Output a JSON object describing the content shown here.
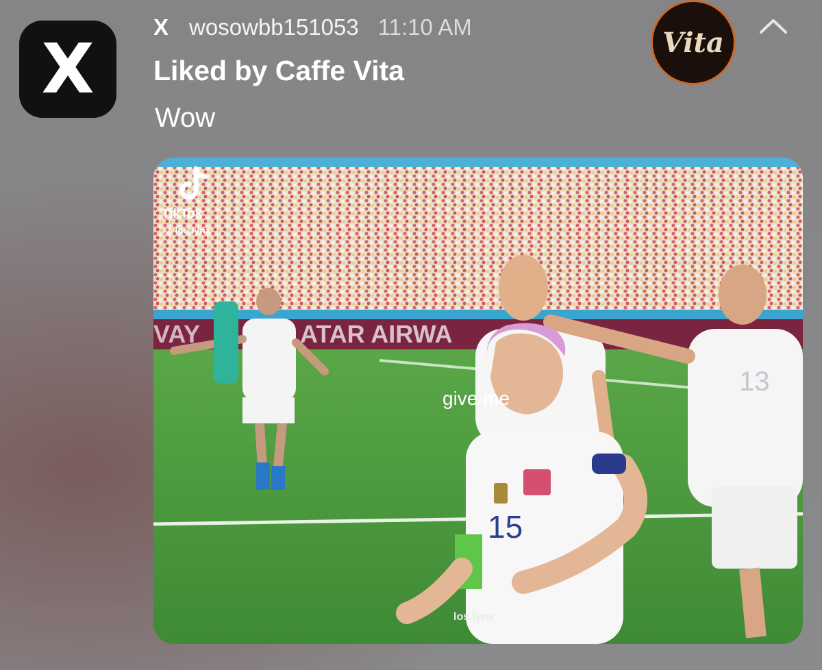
{
  "notification": {
    "app_name": "X",
    "username": "wosowbb151053",
    "time": "11:10 AM",
    "title": "Liked by Caffe Vita",
    "body": "Wow",
    "avatar_text": "Vita",
    "collapse_icon": "chevron-up-icon"
  },
  "media": {
    "caption": "give me",
    "tiktok_brand": "TikTok",
    "tiktok_handle": "@ los.lynx",
    "watermark": "los.lynx",
    "banner_text": "ATAR AIRWA",
    "banner_text_left": "VAY",
    "jersey_number_front": "15",
    "jersey_number_right": "13"
  },
  "colors": {
    "card_bg": "#8a8a8c",
    "app_icon_bg": "#111111",
    "pitch_green": "#4d9a3f",
    "crowd_banner_blue": "#4bb1d6",
    "airways_banner": "#7b1a3a",
    "avatar_ring": "#c96a2a"
  }
}
